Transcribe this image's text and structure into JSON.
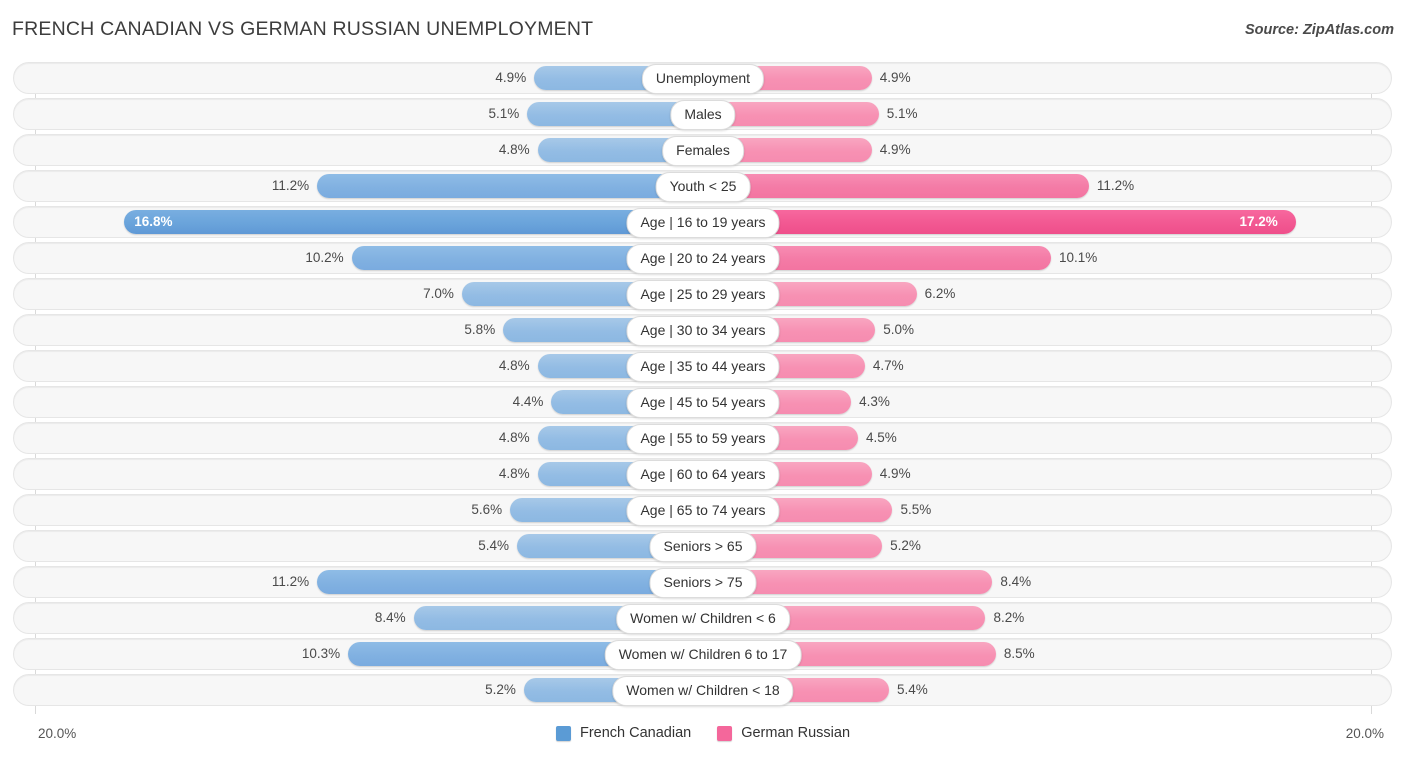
{
  "header": {
    "title": "FRENCH CANADIAN VS GERMAN RUSSIAN UNEMPLOYMENT",
    "source": "Source: ZipAtlas.com"
  },
  "axis": {
    "min_label": "20.0%",
    "max_label": "20.0%"
  },
  "legend": {
    "items": [
      {
        "label": "French Canadian",
        "color": "#5b9bd5"
      },
      {
        "label": "German Russian",
        "color": "#f4679b"
      }
    ]
  },
  "chart_data": {
    "type": "bar",
    "title": "FRENCH CANADIAN VS GERMAN RUSSIAN UNEMPLOYMENT",
    "subtitle": "Source: ZipAtlas.com",
    "orientation": "horizontal-diverging",
    "xlabel": "",
    "ylabel": "",
    "xlim": [
      -20.0,
      20.0
    ],
    "grid": false,
    "legend_position": "bottom-center",
    "categories": [
      "Unemployment",
      "Males",
      "Females",
      "Youth < 25",
      "Age | 16 to 19 years",
      "Age | 20 to 24 years",
      "Age | 25 to 29 years",
      "Age | 30 to 34 years",
      "Age | 35 to 44 years",
      "Age | 45 to 54 years",
      "Age | 55 to 59 years",
      "Age | 60 to 64 years",
      "Age | 65 to 74 years",
      "Seniors > 65",
      "Seniors > 75",
      "Women w/ Children < 6",
      "Women w/ Children 6 to 17",
      "Women w/ Children < 18"
    ],
    "series": [
      {
        "name": "French Canadian",
        "color": "#5b9bd5",
        "values": [
          4.9,
          5.1,
          4.8,
          11.2,
          16.8,
          10.2,
          7.0,
          5.8,
          4.8,
          4.4,
          4.8,
          4.8,
          5.6,
          5.4,
          11.2,
          8.4,
          10.3,
          5.2
        ],
        "labels": [
          "4.9%",
          "5.1%",
          "4.8%",
          "11.2%",
          "16.8%",
          "10.2%",
          "7.0%",
          "5.8%",
          "4.8%",
          "4.4%",
          "4.8%",
          "4.8%",
          "5.6%",
          "5.4%",
          "11.2%",
          "8.4%",
          "10.3%",
          "5.2%"
        ]
      },
      {
        "name": "German Russian",
        "color": "#f4679b",
        "values": [
          4.9,
          5.1,
          4.9,
          11.2,
          17.2,
          10.1,
          6.2,
          5.0,
          4.7,
          4.3,
          4.5,
          4.9,
          5.5,
          5.2,
          8.4,
          8.2,
          8.5,
          5.4
        ],
        "labels": [
          "4.9%",
          "5.1%",
          "4.9%",
          "11.2%",
          "17.2%",
          "10.1%",
          "6.2%",
          "5.0%",
          "4.7%",
          "4.3%",
          "4.5%",
          "4.9%",
          "5.5%",
          "5.2%",
          "8.4%",
          "8.2%",
          "8.5%",
          "5.4%"
        ]
      }
    ]
  }
}
